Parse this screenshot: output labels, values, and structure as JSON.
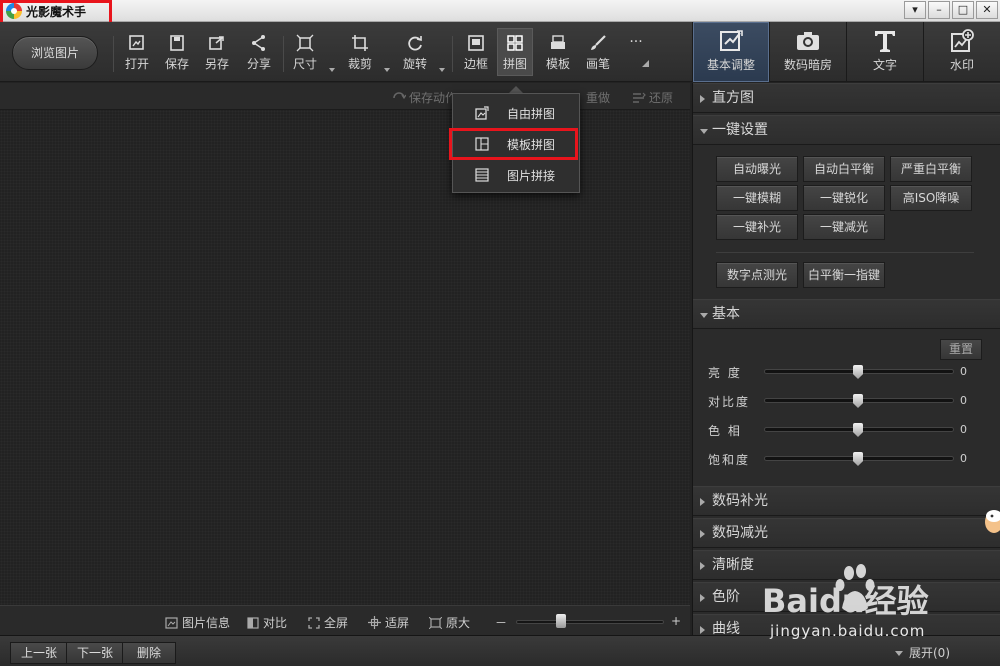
{
  "app": {
    "title": "光影魔术手"
  },
  "window_controls": [
    "▾",
    "–",
    "□",
    "✕"
  ],
  "toolbar": {
    "browse_label": "浏览图片",
    "tools": [
      {
        "label": "打开",
        "icon": "open-icon"
      },
      {
        "label": "保存",
        "icon": "save-icon"
      },
      {
        "label": "另存",
        "icon": "save-as-icon"
      },
      {
        "label": "分享",
        "icon": "share-icon"
      },
      {
        "label": "尺寸",
        "icon": "resize-icon"
      },
      {
        "label": "裁剪",
        "icon": "crop-icon"
      },
      {
        "label": "旋转",
        "icon": "rotate-icon"
      },
      {
        "label": "边框",
        "icon": "border-icon"
      },
      {
        "label": "拼图",
        "icon": "collage-icon",
        "active": true
      },
      {
        "label": "模板",
        "icon": "template-icon"
      },
      {
        "label": "画笔",
        "icon": "brush-icon"
      },
      {
        "label": "···",
        "icon": "more-icon"
      }
    ]
  },
  "right_tabs": [
    {
      "label": "基本调整",
      "icon": "basic-adjust-icon",
      "active": true
    },
    {
      "label": "数码暗房",
      "icon": "camera-icon"
    },
    {
      "label": "文字",
      "icon": "text-icon"
    },
    {
      "label": "水印",
      "icon": "watermark-icon"
    }
  ],
  "canvas_top": {
    "save_action": "保存动作",
    "redo": "重做",
    "restore": "还原"
  },
  "collage_menu": {
    "items": [
      {
        "label": "自由拼图",
        "icon": "free-collage-icon"
      },
      {
        "label": "模板拼图",
        "icon": "template-collage-icon",
        "highlighted": true
      },
      {
        "label": "图片拼接",
        "icon": "image-stitch-icon"
      }
    ]
  },
  "canvas_bottom": {
    "info": "图片信息",
    "compare": "对比",
    "fullscreen": "全屏",
    "fit": "适屏",
    "original": "原大",
    "zoom_minus": "－",
    "zoom_plus": "+"
  },
  "bottom_bar": {
    "prev": "上一张",
    "next": "下一张",
    "delete": "删除",
    "expand": "展开(0)"
  },
  "panel": {
    "histogram": "直方图",
    "one_click": {
      "title": "一键设置",
      "buttons": [
        "自动曝光",
        "自动白平衡",
        "严重白平衡",
        "一键模糊",
        "一键锐化",
        "高ISO降噪",
        "一键补光",
        "一键减光",
        "数字点测光",
        "白平衡一指键"
      ]
    },
    "basic": {
      "title": "基本",
      "reset": "重置",
      "sliders": [
        {
          "label": "亮 度",
          "value": "0"
        },
        {
          "label": "对比度",
          "value": "0"
        },
        {
          "label": "色 相",
          "value": "0"
        },
        {
          "label": "饱和度",
          "value": "0"
        }
      ]
    },
    "sections": [
      "数码补光",
      "数码减光",
      "清晰度",
      "色阶",
      "曲线"
    ]
  },
  "watermark": {
    "brand": "Baidu经验",
    "url": "jingyan.baidu.com"
  },
  "colors": {
    "highlight": "#e8141c",
    "active_tab": "#2b3a4f",
    "background": "#232323"
  }
}
